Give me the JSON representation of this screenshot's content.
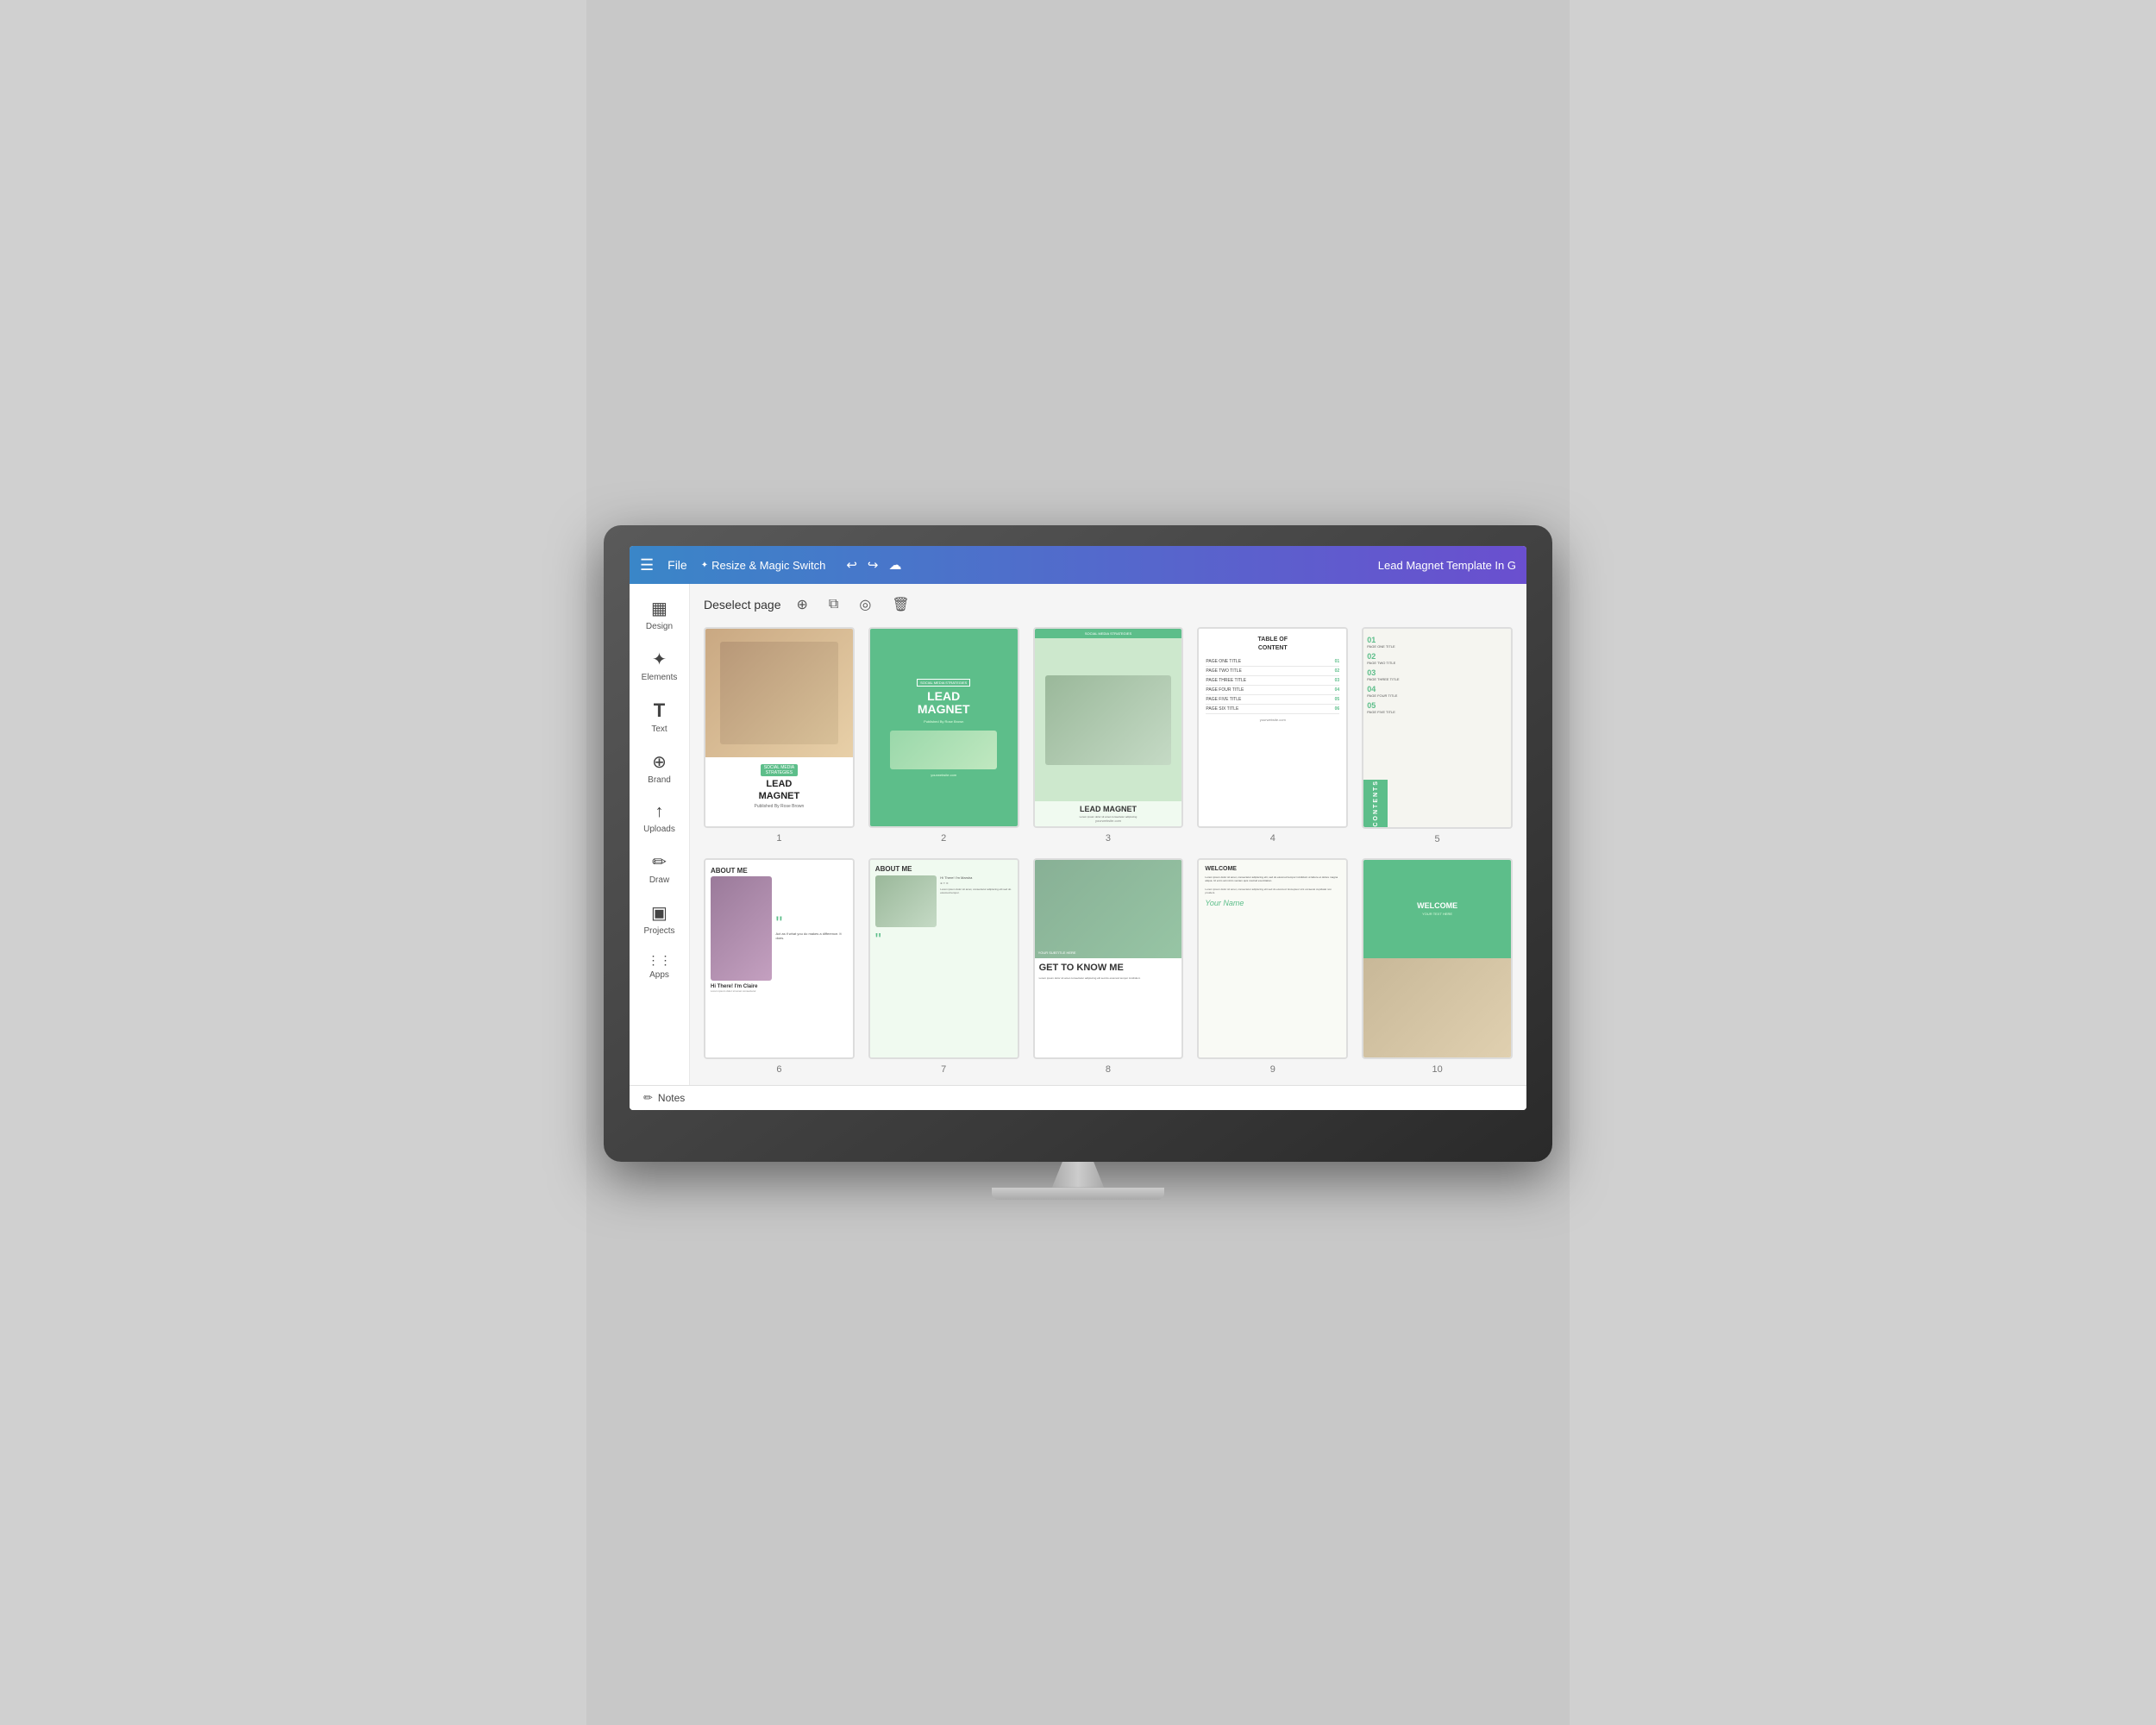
{
  "app": {
    "title": "Lead Magnet Template In G",
    "topbar": {
      "menu_label": "☰",
      "file_label": "File",
      "resize_label": "Resize & Magic Switch",
      "undo_icon": "↩",
      "redo_icon": "↪",
      "cloud_icon": "☁"
    },
    "toolbar": {
      "deselect_label": "Deselect page",
      "add_icon": "+",
      "copy_icon": "⧉",
      "hide_icon": "◎",
      "delete_icon": "🗑"
    },
    "notes_label": "Notes"
  },
  "sidebar": {
    "items": [
      {
        "id": "design",
        "label": "Design",
        "icon": "▦"
      },
      {
        "id": "elements",
        "label": "Elements",
        "icon": "✦"
      },
      {
        "id": "text",
        "label": "Text",
        "icon": "T"
      },
      {
        "id": "brand",
        "label": "Brand",
        "icon": "⊕"
      },
      {
        "id": "uploads",
        "label": "Uploads",
        "icon": "↑"
      },
      {
        "id": "draw",
        "label": "Draw",
        "icon": "✏"
      },
      {
        "id": "projects",
        "label": "Projects",
        "icon": "▣"
      },
      {
        "id": "apps",
        "label": "Apps",
        "icon": "⋮⋮"
      }
    ]
  },
  "pages": [
    {
      "num": "1",
      "tag": "SOCIAL MEDIA STRATEGIES",
      "title": "LEAD MAGNET",
      "subtitle": "Published By Rose Brown",
      "url": ""
    },
    {
      "num": "2",
      "tag": "SOCIAL MEDIA STRATEGIES",
      "title": "LEAD MAGNET",
      "subtitle": "Published By Rose Brown"
    },
    {
      "num": "3",
      "tag": "SOCIAL MEDIA STRATEGIES",
      "title": "LEAD MAGNET",
      "url": "yourwebsite.com"
    },
    {
      "num": "4",
      "title": "TABLE OF CONTENT",
      "rows": [
        {
          "title": "PAGE ONE TITLE",
          "num": "01"
        },
        {
          "title": "PAGE TWO TITLE",
          "num": "02"
        },
        {
          "title": "PAGE THREE TITLE",
          "num": "03"
        },
        {
          "title": "PAGE FOUR TITLE",
          "num": "04"
        },
        {
          "title": "PAGE FIVE TITLE",
          "num": "05"
        },
        {
          "title": "PAGE SIX TITLE",
          "num": "06"
        }
      ],
      "url": "yourwebsite.com"
    },
    {
      "num": "5",
      "items": [
        {
          "num": "01",
          "name": "PAGE ONE TITLE"
        },
        {
          "num": "02",
          "name": "PAGE TWO TITLE"
        },
        {
          "num": "03",
          "name": "PAGE THREE TITLE"
        },
        {
          "num": "04",
          "name": "PAGE FOUR TITLE"
        },
        {
          "num": "05",
          "name": "PAGE FIVE TITLE"
        }
      ],
      "sidebar_text": "CONTENTS"
    },
    {
      "num": "6",
      "title": "ABOUT ME",
      "name": "Hi There! I'm Claire",
      "quote_text": "Act as if what you do makes a difference. It does."
    },
    {
      "num": "7",
      "title": "ABOUT ME",
      "name": "Hi There! I'm Marsha"
    },
    {
      "num": "8",
      "label": "YOUR SUBTITLE HERE",
      "title": "GET TO KNOW ME"
    },
    {
      "num": "9",
      "title": "WELCOME",
      "body": "Lorem ipsum dolor sit amet, consectetur adipiscing elit, sed do eiusmod tempor incididunt ut labore et dolore magna aliqua.",
      "signature": "Your Name"
    },
    {
      "num": "10",
      "title": "WELCOME",
      "subtitle": "YOUR TEXT HERE"
    }
  ],
  "colors": {
    "primary": "#5dbe8a",
    "topbar_start": "#3a86c8",
    "topbar_end": "#6a4fcf",
    "text_dark": "#333333",
    "text_light": "#ffffff",
    "bg_light": "#f5f5f5"
  }
}
